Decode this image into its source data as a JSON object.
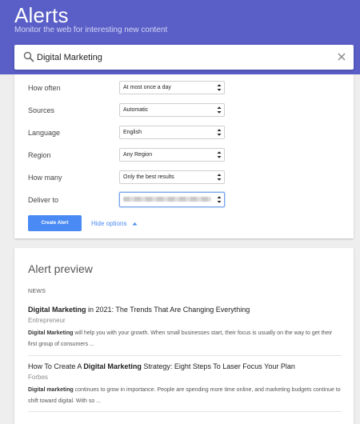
{
  "header": {
    "title": "Alerts",
    "subtitle": "Monitor the web for interesting new content",
    "bg_color": "#5a5ec7"
  },
  "search": {
    "value": "Digital Marketing",
    "icon": "search-icon",
    "clear_icon": "close-icon"
  },
  "options": {
    "how_often": {
      "label": "How often",
      "value": "At most once a day"
    },
    "sources": {
      "label": "Sources",
      "value": "Automatic"
    },
    "language": {
      "label": "Language",
      "value": "English"
    },
    "region": {
      "label": "Region",
      "value": "Any Region"
    },
    "how_many": {
      "label": "How many",
      "value": "Only the best results"
    },
    "deliver_to": {
      "label": "Deliver to",
      "value": ""
    },
    "create_label": "Create Alert",
    "hide_label": "Hide options",
    "accent_color": "#4a8af4"
  },
  "preview": {
    "title": "Alert preview",
    "section_label": "NEWS",
    "articles": [
      {
        "title_bold": "Digital Marketing",
        "title_rest": " in 2021: The Trends That Are Changing Everything",
        "source": "Entrepreneur",
        "snippet_bold": "Digital Marketing",
        "snippet_rest": " will help you with your growth. When small businesses start, their focus is usually on the way to get their first group of consumers ..."
      },
      {
        "title_pre": "How To Create A ",
        "title_bold": "Digital Marketing",
        "title_rest": " Strategy: Eight Steps To Laser Focus Your Plan",
        "source": "Forbes",
        "snippet_bold": "Digital marketing",
        "snippet_rest": " continues to grow in importance. People are spending more time online, and marketing budgets continue to shift toward digital. With so ..."
      }
    ]
  }
}
